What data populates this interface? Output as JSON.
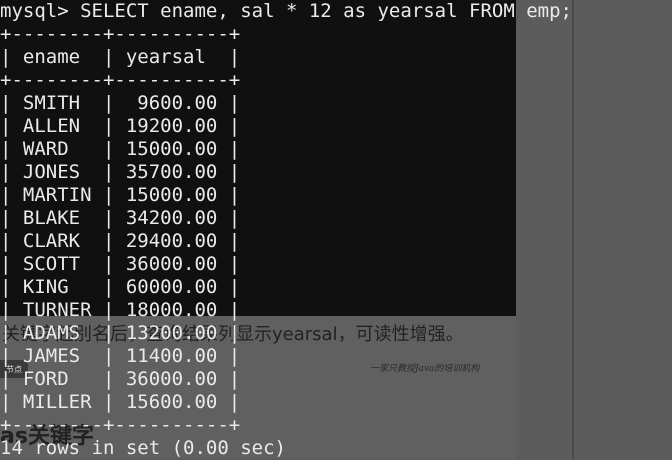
{
  "background_doc": {
    "caption": "关键字起别名后，查询结果列显示yearsal，可读性增强。",
    "watermark": "一家只教授Java的培训机构",
    "logo_text": "节点",
    "heading": "as关键字"
  },
  "terminal": {
    "prompt": "mysql> ",
    "command": "SELECT ename, sal * 12 as yearsal FROM emp;",
    "border_line": "+--------+----------+",
    "header_line": "| ename  | yearsal  |",
    "rows": [
      "| SMITH  |  9600.00 |",
      "| ALLEN  | 19200.00 |",
      "| WARD   | 15000.00 |",
      "| JONES  | 35700.00 |",
      "| MARTIN | 15000.00 |",
      "| BLAKE  | 34200.00 |",
      "| CLARK  | 29400.00 |",
      "| SCOTT  | 36000.00 |",
      "| KING   | 60000.00 |",
      "| TURNER | 18000.00 |",
      "| ADAMS  | 13200.00 |",
      "| JAMES  | 11400.00 |",
      "| FORD   | 36000.00 |",
      "| MILLER | 15600.00 |"
    ],
    "footer": "14 rows in set (0.00 sec)"
  }
}
